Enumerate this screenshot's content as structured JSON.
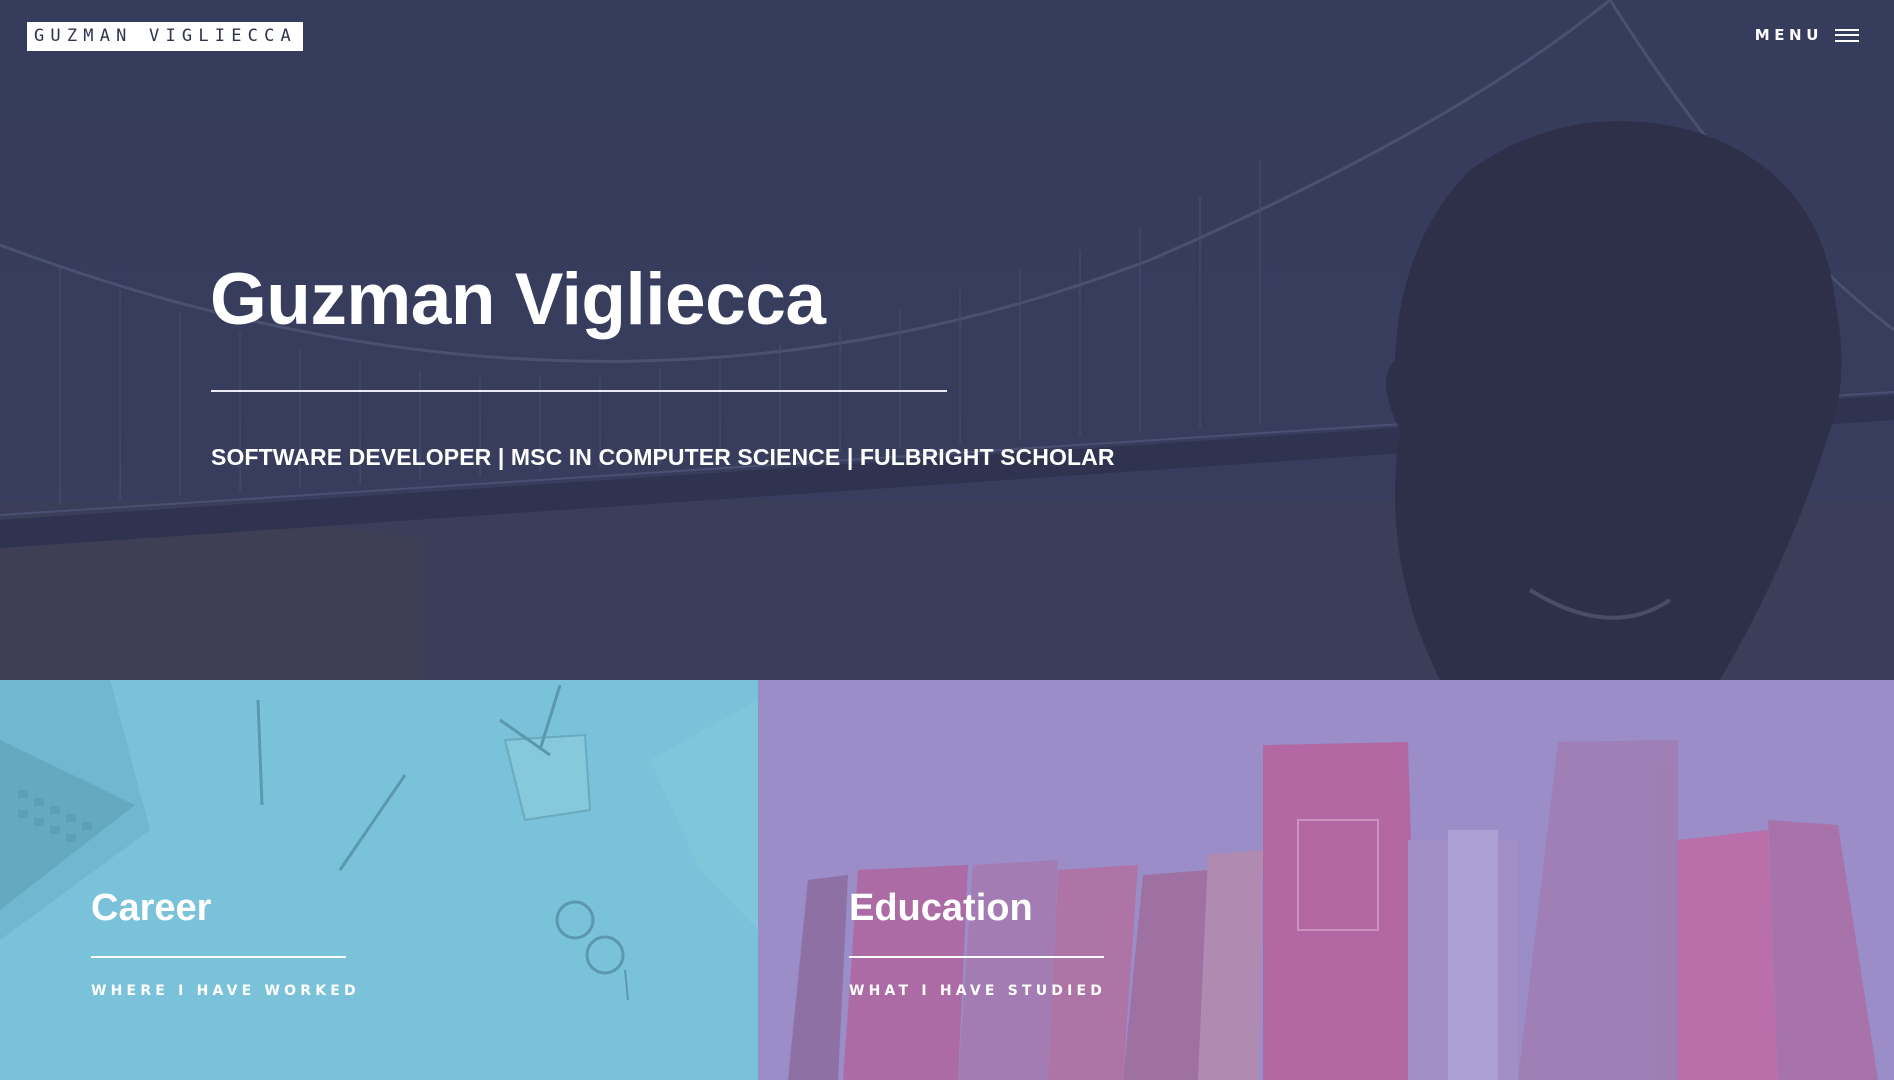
{
  "header": {
    "logo_text": "GUZMAN VIGLIECCA",
    "menu_label": "MENU"
  },
  "hero": {
    "title": "Guzman Vigliecca",
    "subtitle": "SOFTWARE DEVELOPER | MSC IN COMPUTER SCIENCE | FULBRIGHT SCHOLAR",
    "overlay_color": "#363c5c"
  },
  "tiles": [
    {
      "title": "Career",
      "subtitle": "WHERE I HAVE WORKED",
      "color": "#79c2da"
    },
    {
      "title": "Education",
      "subtitle": "WHAT I HAVE STUDIED",
      "color": "#9a8dc8"
    }
  ],
  "icons": {
    "menu": "hamburger-icon"
  }
}
